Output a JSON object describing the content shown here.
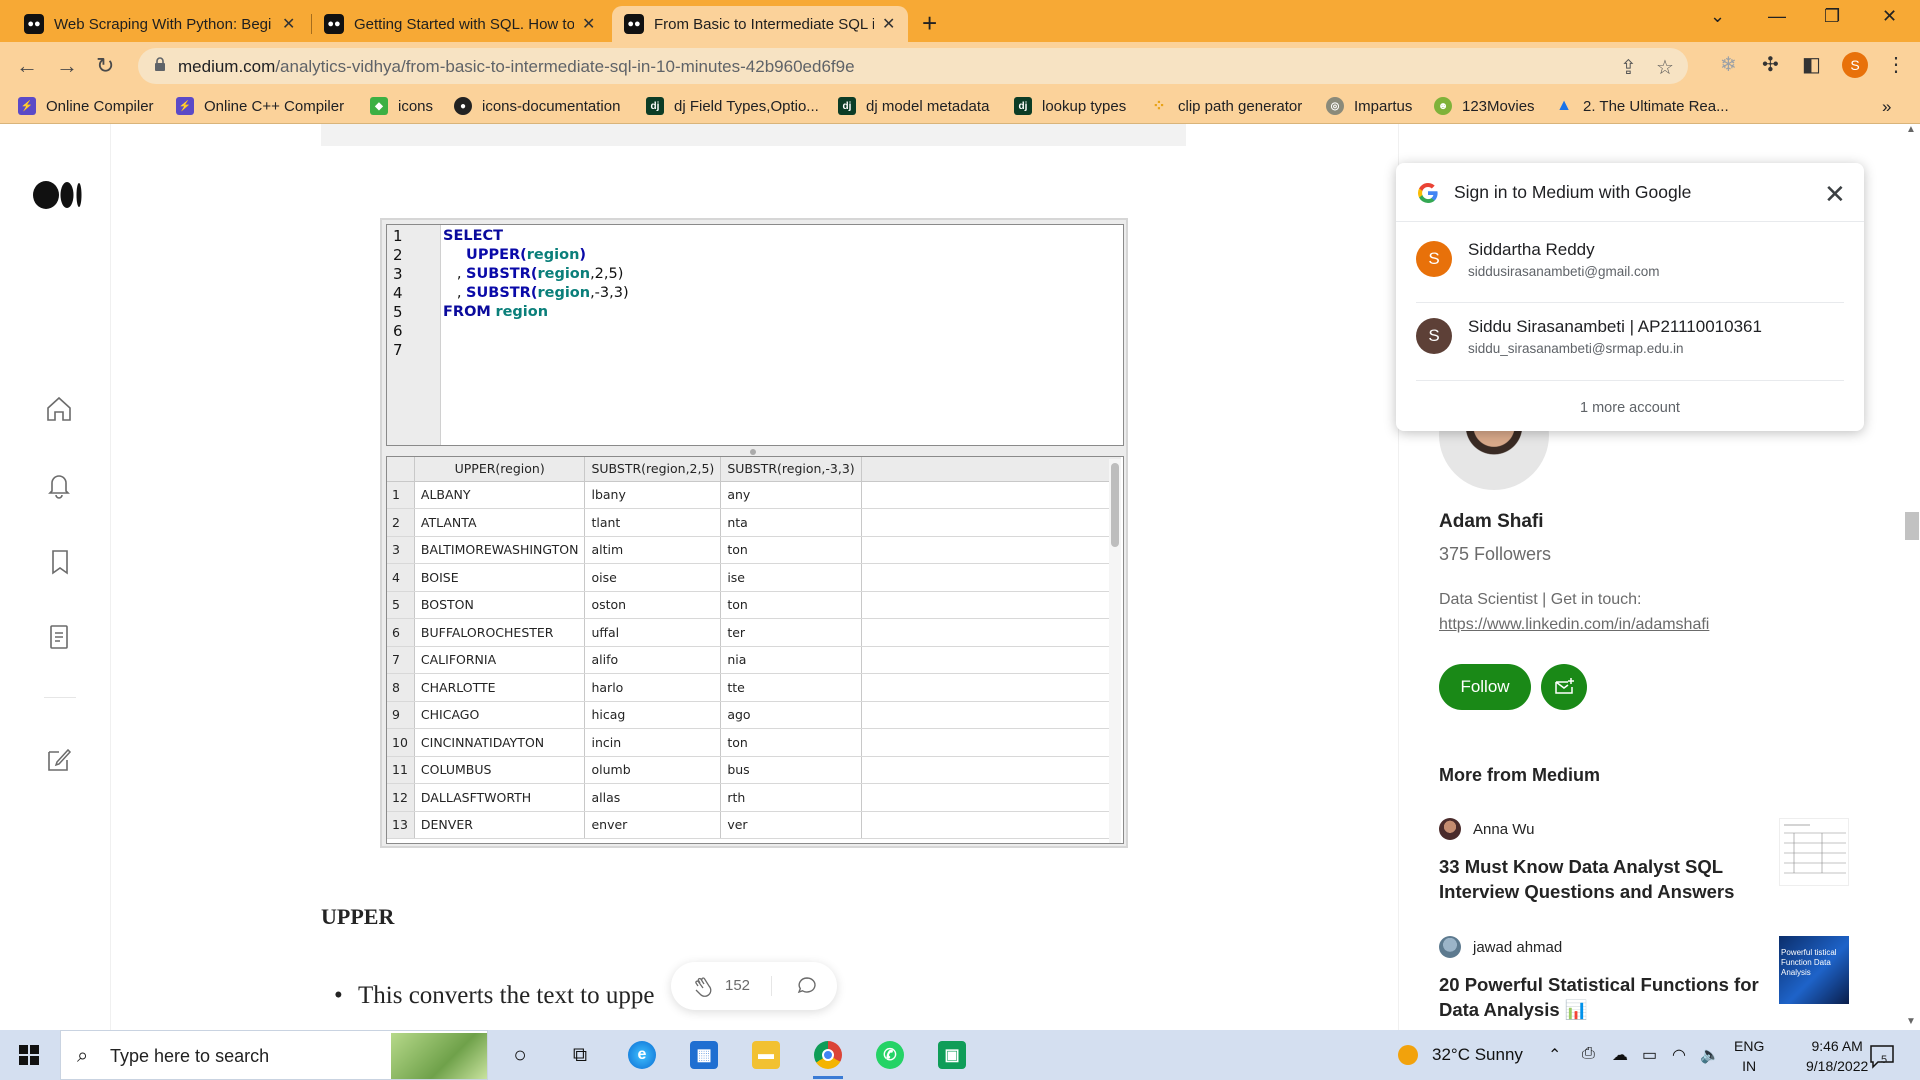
{
  "browser": {
    "tabs": [
      {
        "title": "Web Scraping With Python: Begi",
        "active": false
      },
      {
        "title": "Getting Started with SQL. How to",
        "active": false
      },
      {
        "title": "From Basic to Intermediate SQL i",
        "active": true
      }
    ],
    "url_host": "medium.com",
    "url_path": "/analytics-vidhya/from-basic-to-intermediate-sql-in-10-minutes-42b960ed6f9e",
    "profile_initial": "S",
    "bookmarks": [
      {
        "label": "Online Compiler",
        "icon": "bolt-icon",
        "color": "#5b4ac7"
      },
      {
        "label": "Online C++ Compiler",
        "icon": "bolt-icon",
        "color": "#5b4ac7"
      },
      {
        "label": "icons",
        "icon": "icons8-icon",
        "color": "#3cb043"
      },
      {
        "label": "icons-documentation",
        "icon": "github-icon",
        "color": "#222222"
      },
      {
        "label": "dj Field Types,Optio...",
        "icon": "django-icon",
        "color": "#0c3c26"
      },
      {
        "label": "dj model metadata",
        "icon": "django-icon",
        "color": "#0c3c26"
      },
      {
        "label": "lookup types",
        "icon": "django-icon",
        "color": "#0c3c26"
      },
      {
        "label": "clip path generator",
        "icon": "dots-icon",
        "color": "#e8a317"
      },
      {
        "label": "Impartus",
        "icon": "impartus-icon",
        "color": "#8a8a7a"
      },
      {
        "label": "123Movies",
        "icon": "movies-icon",
        "color": "#7fb23a"
      },
      {
        "label": "2. The Ultimate Rea...",
        "icon": "drive-icon",
        "color": "#1a73e8"
      }
    ]
  },
  "article": {
    "code_lines": [
      "1",
      "2",
      "3",
      "4",
      "5",
      "6",
      "7"
    ],
    "code": {
      "select": "SELECT",
      "upper_fn": "UPPER(",
      "upper_arg": "region",
      "substr_fn": "SUBSTR(",
      "substr_arg": "region",
      "substr1_tail": ",2,5)",
      "substr2_tail": ",-3,3)",
      "comma": ", ",
      "from": "FROM",
      "from_table": "region"
    },
    "grid_columns": [
      "UPPER(region)",
      "SUBSTR(region,2,5)",
      "SUBSTR(region,-3,3)"
    ],
    "grid_rows": [
      [
        "1",
        "ALBANY",
        "lbany",
        "any"
      ],
      [
        "2",
        "ATLANTA",
        "tlant",
        "nta"
      ],
      [
        "3",
        "BALTIMOREWASHINGTON",
        "altim",
        "ton"
      ],
      [
        "4",
        "BOISE",
        "oise",
        "ise"
      ],
      [
        "5",
        "BOSTON",
        "oston",
        "ton"
      ],
      [
        "6",
        "BUFFALOROCHESTER",
        "uffal",
        "ter"
      ],
      [
        "7",
        "CALIFORNIA",
        "alifo",
        "nia"
      ],
      [
        "8",
        "CHARLOTTE",
        "harlo",
        "tte"
      ],
      [
        "9",
        "CHICAGO",
        "hicag",
        "ago"
      ],
      [
        "10",
        "CINCINNATIDAYTON",
        "incin",
        "ton"
      ],
      [
        "11",
        "COLUMBUS",
        "olumb",
        "bus"
      ],
      [
        "12",
        "DALLASFTWORTH",
        "allas",
        "rth"
      ],
      [
        "13",
        "DENVER",
        "enver",
        "ver"
      ]
    ],
    "heading": "UPPER",
    "bullet_text": "This converts the text to uppe",
    "clap_count": "152"
  },
  "sidebar": {
    "author_name": "Adam Shafi",
    "followers": "375 Followers",
    "bio_line": "Data Scientist | Get in touch:",
    "bio_link": "https://www.linkedin.com/in/adamshafi",
    "follow_label": "Follow",
    "more_heading": "More from Medium",
    "recommendations": [
      {
        "author": "Anna Wu",
        "title": "33 Must Know Data Analyst SQL Interview Questions and Answers"
      },
      {
        "author": "jawad ahmad",
        "title": "20 Powerful Statistical Functions for Data Analysis 📊",
        "thumb_text": "Powerful tistical Function Data Analysis"
      }
    ]
  },
  "google_popup": {
    "title": "Sign in to Medium with Google",
    "accounts": [
      {
        "initial": "S",
        "name": "Siddartha Reddy",
        "email": "siddusirasanambeti@gmail.com",
        "color": "#e8710a"
      },
      {
        "initial": "S",
        "name": "Siddu Sirasanambeti | AP21110010361",
        "email": "siddu_sirasanambeti@srmap.edu.in",
        "color": "#5d4037"
      }
    ],
    "more": "1 more account"
  },
  "taskbar": {
    "search_placeholder": "Type here to search",
    "weather": "32°C  Sunny",
    "lang_line1": "ENG",
    "lang_line2": "IN",
    "time": "9:46 AM",
    "date": "9/18/2022",
    "notif_count": "5"
  },
  "colors": {
    "chrome_accent": "#f7a935",
    "medium_green": "#1a8917"
  }
}
